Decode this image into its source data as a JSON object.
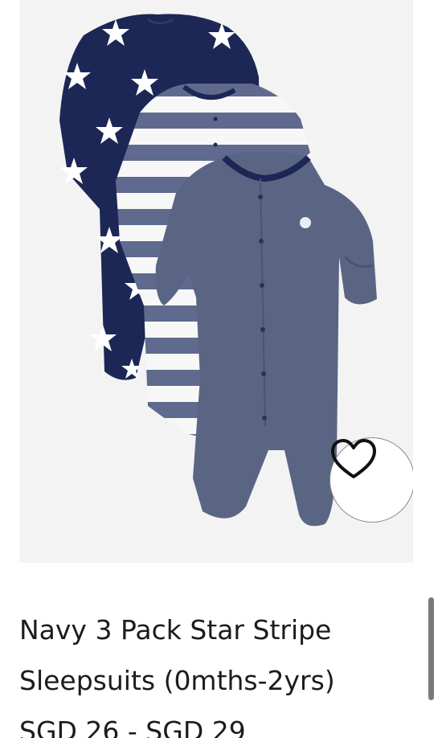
{
  "product": {
    "title": "Navy 3 Pack Star Stripe Sleepsuits (0mths-2yrs)",
    "price_range": "SGD 26 - SGD 29"
  },
  "wishlist": {
    "icon": "heart-outline-icon"
  },
  "colors": {
    "image_background": "#f3f3f3",
    "navy": "#1c2755",
    "stripe_blue": "#5f6a8e",
    "marl_navy": "#5a6584",
    "text": "#1c1c1c"
  }
}
